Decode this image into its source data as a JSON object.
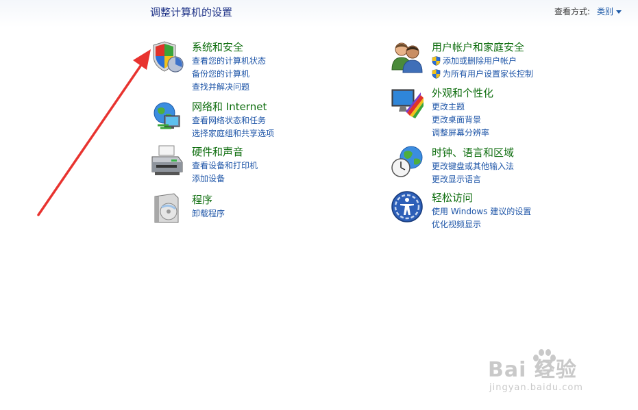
{
  "header": {
    "title": "调整计算机的设置",
    "view_by_label": "查看方式:",
    "view_by_value": "类别"
  },
  "categories": {
    "system_security": {
      "title": "系统和安全",
      "links": [
        "查看您的计算机状态",
        "备份您的计算机",
        "查找并解决问题"
      ]
    },
    "network": {
      "title": "网络和 Internet",
      "links": [
        "查看网络状态和任务",
        "选择家庭组和共享选项"
      ]
    },
    "hardware": {
      "title": "硬件和声音",
      "links": [
        "查看设备和打印机",
        "添加设备"
      ]
    },
    "programs": {
      "title": "程序",
      "links": [
        "卸载程序"
      ]
    },
    "user_accounts": {
      "title": "用户帐户和家庭安全",
      "links": [
        "添加或删除用户帐户",
        "为所有用户设置家长控制"
      ]
    },
    "appearance": {
      "title": "外观和个性化",
      "links": [
        "更改主题",
        "更改桌面背景",
        "调整屏幕分辨率"
      ]
    },
    "clock": {
      "title": "时钟、语言和区域",
      "links": [
        "更改键盘或其他输入法",
        "更改显示语言"
      ]
    },
    "ease": {
      "title": "轻松访问",
      "links": [
        "使用 Windows 建议的设置",
        "优化视频显示"
      ]
    }
  },
  "watermark": {
    "main": "Bai  经验",
    "sub": "jingyan.baidu.com"
  },
  "colors": {
    "title_blue": "#1e3287",
    "category_green": "#0c6c0c",
    "link_blue": "#1f56a8",
    "annotation_red": "#e8332f"
  }
}
